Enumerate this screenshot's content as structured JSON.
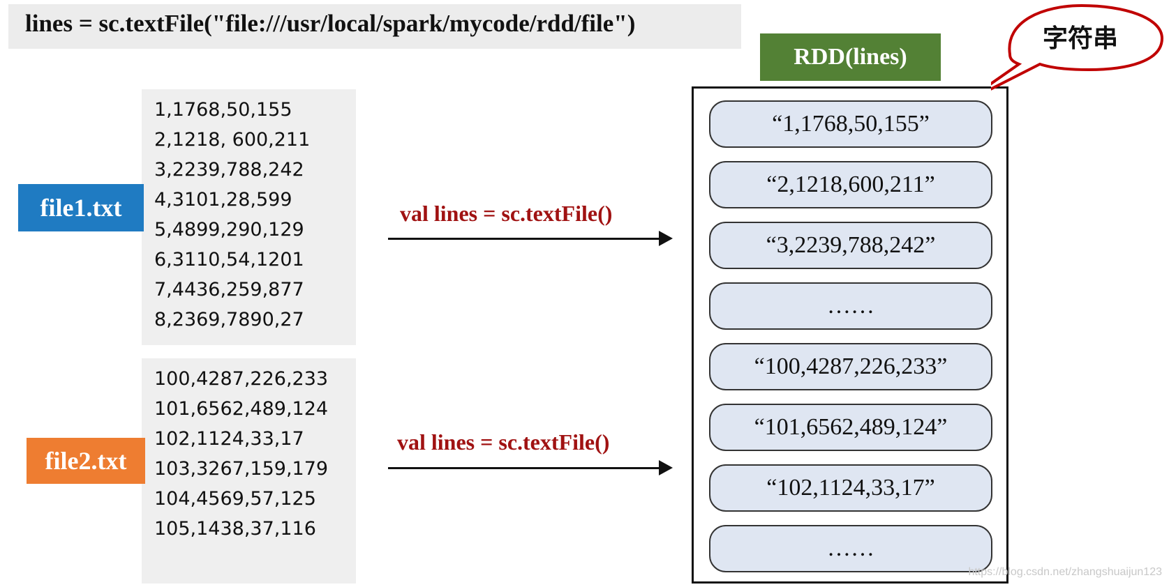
{
  "code_line": "lines = sc.textFile(\"file:///usr/local/spark/mycode/rdd/file\")",
  "files": [
    {
      "label": "file1.txt",
      "color": "#1f7bc2",
      "lines": [
        "1,1768,50,155",
        "2,1218, 600,211",
        "3,2239,788,242",
        "4,3101,28,599",
        "5,4899,290,129",
        "6,3110,54,1201",
        "7,4436,259,877",
        "8,2369,7890,27"
      ]
    },
    {
      "label": "file2.txt",
      "color": "#ee7d31",
      "lines": [
        "100,4287,226,233",
        "101,6562,489,124",
        "102,1124,33,17",
        "103,3267,159,179",
        "104,4569,57,125",
        "105,1438,37,116"
      ]
    }
  ],
  "operation_labels": [
    "val lines = sc.textFile()",
    "val lines = sc.textFile()"
  ],
  "rdd": {
    "title": "RDD(lines)",
    "title_color": "#538135",
    "items": [
      "“1,1768,50,155”",
      "“2,1218,600,211”",
      "“3,2239,788,242”",
      "……",
      "“100,4287,226,233”",
      "“101,6562,489,124”",
      "“102,1124,33,17”",
      "……"
    ]
  },
  "callout": {
    "text": "字符串",
    "border_color": "#c00000"
  },
  "watermark": "https://blog.csdn.net/zhangshuaijun123"
}
